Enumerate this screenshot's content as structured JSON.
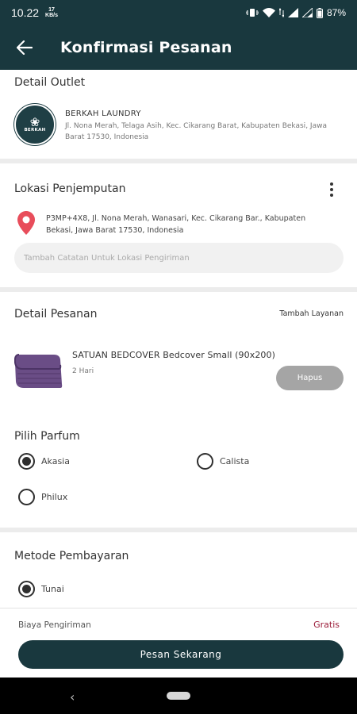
{
  "status_bar": {
    "time": "10.22",
    "speed_value": "17",
    "speed_unit": "KB/s",
    "battery": "87%"
  },
  "app_bar": {
    "title": "Konfirmasi Pesanan",
    "back_icon": "arrow-left-icon"
  },
  "outlet": {
    "section_title": "Detail Outlet",
    "logo_text": "BERKAH",
    "name": "BERKAH LAUNDRY",
    "address": "Jl. Nona Merah, Telaga Asih, Kec. Cikarang Barat, Kabupaten Bekasi, Jawa Barat 17530, Indonesia"
  },
  "pickup": {
    "section_title": "Lokasi Penjemputan",
    "address": "P3MP+4X8, Jl. Nona Merah, Wanasari, Kec. Cikarang Bar., Kabupaten Bekasi, Jawa Barat 17530, Indonesia",
    "note_placeholder": "Tambah Catatan Untuk Lokasi Pengiriman"
  },
  "order": {
    "section_title": "Detail Pesanan",
    "add_service": "Tambah Layanan",
    "item_name": "SATUAN  BEDCOVER Bedcover Small (90x200)",
    "item_duration": "2 Hari",
    "remove_label": "Hapus"
  },
  "perfume": {
    "section_title": "Pilih Parfum",
    "options": [
      {
        "label": "Akasia",
        "selected": true
      },
      {
        "label": "Calista",
        "selected": false
      },
      {
        "label": "Philux",
        "selected": false
      }
    ]
  },
  "payment": {
    "section_title": "Metode Pembayaran",
    "options": [
      {
        "label": "Tunai",
        "selected": true
      }
    ]
  },
  "footer": {
    "shipping_label": "Biaya Pengiriman",
    "shipping_value": "Gratis",
    "submit_label": "Pesan Sekarang"
  },
  "colors": {
    "primary": "#19383e",
    "accent_free": "#9b1d3a",
    "product": "#6a4d86"
  }
}
